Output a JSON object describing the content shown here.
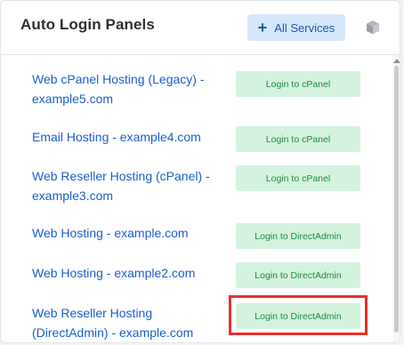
{
  "header": {
    "title": "Auto Login Panels",
    "all_services_label": "All Services",
    "all_services_icon": "plus-icon",
    "extra_icon": "cube-icon"
  },
  "rows": [
    {
      "name": "Web cPanel Hosting (Legacy) - example5.com",
      "button": "Login to cPanel"
    },
    {
      "name": "Email Hosting - example4.com",
      "button": "Login to cPanel"
    },
    {
      "name": "Web Reseller Hosting (cPanel) - example3.com",
      "button": "Login to cPanel"
    },
    {
      "name": "Web Hosting - example.com",
      "button": "Login to DirectAdmin"
    },
    {
      "name": "Web Hosting - example2.com",
      "button": "Login to DirectAdmin"
    },
    {
      "name": "Web Reseller Hosting (DirectAdmin) - example.com",
      "button": "Login to DirectAdmin"
    }
  ],
  "colors": {
    "link": "#1a5fcc",
    "button_bg": "#d4f3de",
    "button_text": "#1f8a3f",
    "primary_button_bg": "#d6e7fb",
    "highlight": "#e8302b"
  }
}
